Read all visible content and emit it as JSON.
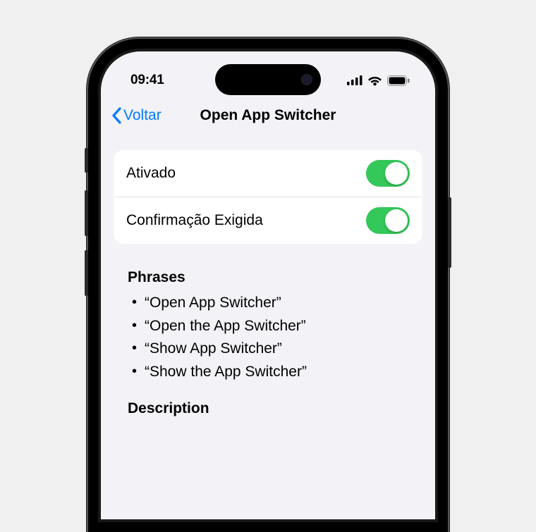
{
  "status": {
    "time": "09:41"
  },
  "nav": {
    "back": "Voltar",
    "title": "Open App Switcher"
  },
  "settings": {
    "enabled_label": "Ativado",
    "enabled_value": true,
    "confirm_label": "Confirmação Exigida",
    "confirm_value": true
  },
  "phrases": {
    "header": "Phrases",
    "items": [
      "“Open App Switcher”",
      "“Open the App Switcher”",
      "“Show App Switcher”",
      "“Show the App Switcher”"
    ]
  },
  "description": {
    "header": "Description"
  }
}
